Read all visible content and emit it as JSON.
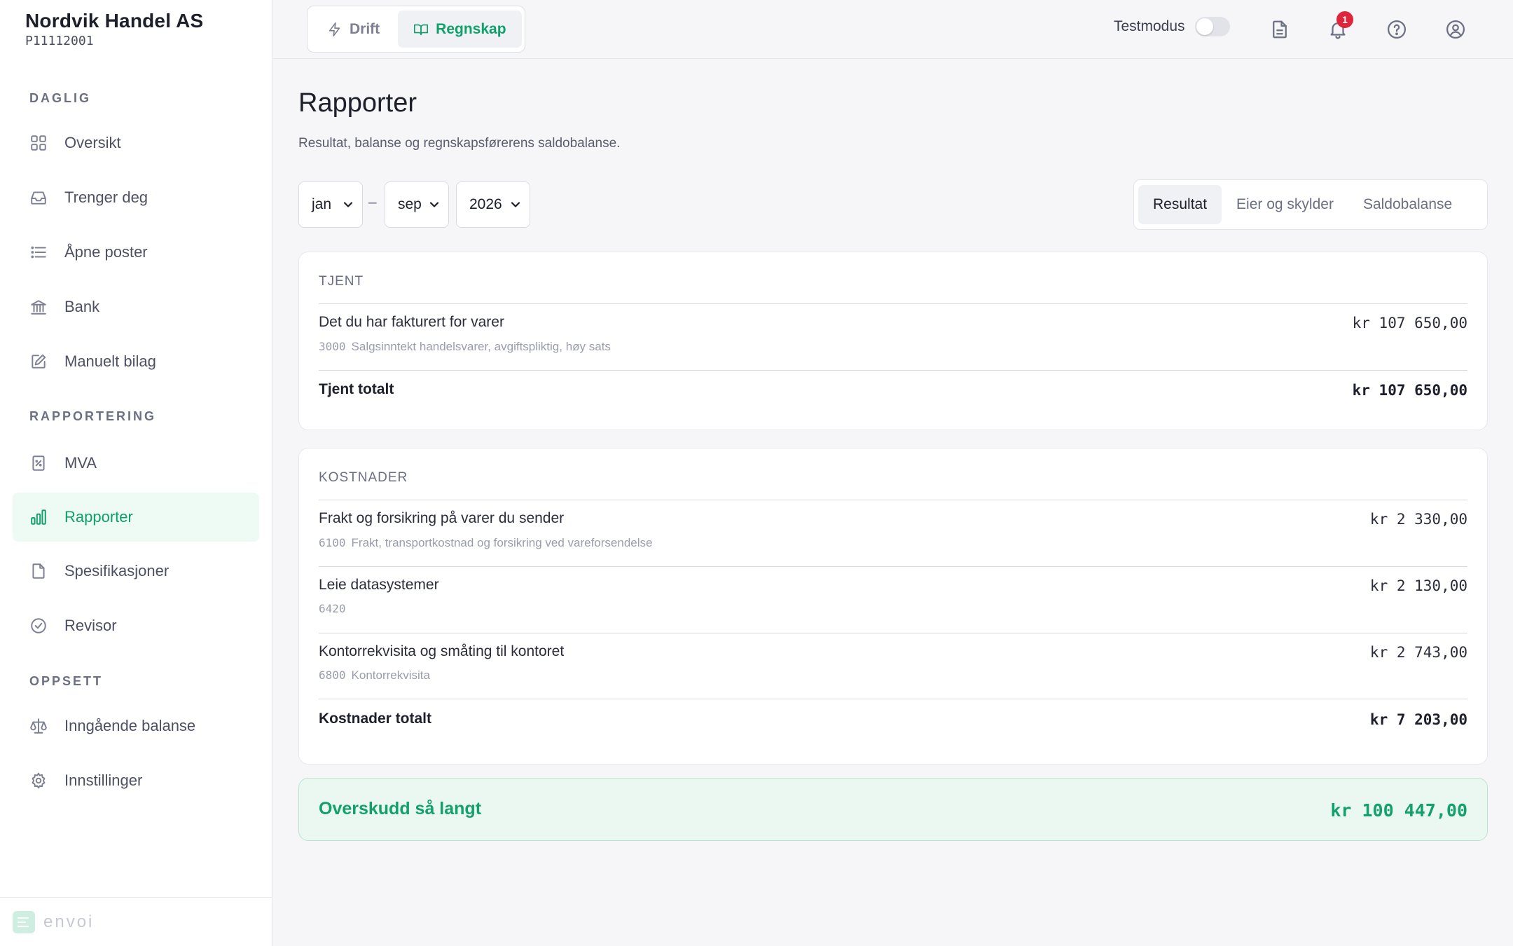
{
  "company": {
    "name": "Nordvik Handel AS",
    "id": "P11112001"
  },
  "sidebar": {
    "sections": [
      {
        "label": "DAGLIG",
        "items": [
          {
            "label": "Oversikt",
            "icon": "grid-icon"
          },
          {
            "label": "Trenger deg",
            "icon": "inbox-icon"
          },
          {
            "label": "Åpne poster",
            "icon": "list-icon"
          },
          {
            "label": "Bank",
            "icon": "bank-icon"
          },
          {
            "label": "Manuelt bilag",
            "icon": "edit-icon"
          }
        ]
      },
      {
        "label": "RAPPORTERING",
        "items": [
          {
            "label": "MVA",
            "icon": "percent-document-icon"
          },
          {
            "label": "Rapporter",
            "icon": "bar-chart-icon",
            "active": true
          },
          {
            "label": "Spesifikasjoner",
            "icon": "file-icon"
          },
          {
            "label": "Revisor",
            "icon": "check-circle-icon"
          }
        ]
      },
      {
        "label": "OPPSETT",
        "items": [
          {
            "label": "Inngående balanse",
            "icon": "scale-icon"
          },
          {
            "label": "Innstillinger",
            "icon": "gear-icon"
          }
        ]
      }
    ],
    "footer_logo": "envoi"
  },
  "topbar": {
    "modes": [
      {
        "label": "Drift",
        "icon": "lightning-icon",
        "active": false
      },
      {
        "label": "Regnskap",
        "icon": "book-icon",
        "active": true
      }
    ],
    "testmode_label": "Testmodus",
    "testmode_on": false,
    "notification_count": "1",
    "icons": [
      "document-icon",
      "bell-icon",
      "help-icon",
      "user-icon"
    ]
  },
  "page": {
    "title": "Rapporter",
    "subtitle": "Resultat, balanse og regnskapsførerens saldobalanse.",
    "filters": {
      "from_month": "jan",
      "separator": "–",
      "to_month": "sep",
      "year": "2026"
    },
    "tabs": [
      {
        "label": "Resultat",
        "active": true
      },
      {
        "label": "Eier og skylder",
        "active": false
      },
      {
        "label": "Saldobalanse",
        "active": false
      }
    ]
  },
  "income": {
    "heading": "TJENT",
    "rows": [
      {
        "title": "Det du har fakturert for varer",
        "account": "3000",
        "account_name": "Salgsinntekt handelsvarer, avgiftspliktig, høy sats",
        "amount": "kr 107 650,00"
      }
    ],
    "total_label": "Tjent totalt",
    "total_amount": "kr 107 650,00"
  },
  "costs": {
    "heading": "KOSTNADER",
    "rows": [
      {
        "title": "Frakt og forsikring på varer du sender",
        "account": "6100",
        "account_name": "Frakt, transportkostnad og forsikring ved vareforsendelse",
        "amount": "kr 2 330,00"
      },
      {
        "title": "Leie datasystemer",
        "account": "6420",
        "account_name": "",
        "amount": "kr 2 130,00"
      },
      {
        "title": "Kontorrekvisita og småting til kontoret",
        "account": "6800",
        "account_name": "Kontorrekvisita",
        "amount": "kr 2 743,00"
      }
    ],
    "total_label": "Kostnader totalt",
    "total_amount": "kr 7 203,00"
  },
  "profit": {
    "label": "Overskudd så langt",
    "amount": "kr 100 447,00"
  },
  "colors": {
    "accent": "#10a06a",
    "badge": "#e0243c",
    "profit_bg": "#eaf8f1"
  }
}
